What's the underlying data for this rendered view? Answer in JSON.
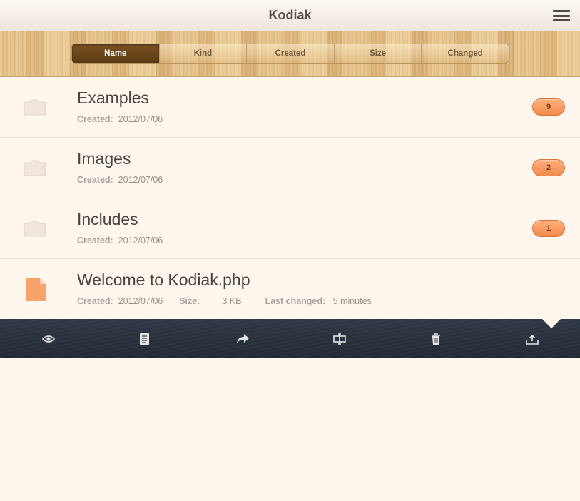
{
  "app": {
    "title": "Kodiak"
  },
  "icons": {
    "menu": "hamburger-menu-icon",
    "folder": "folder-icon",
    "file": "php-file-icon",
    "toolbar": [
      "eye-icon",
      "document-icon",
      "share-arrow-icon",
      "rename-icon",
      "trash-icon",
      "upload-icon"
    ]
  },
  "sort": {
    "options": [
      "Name",
      "Kind",
      "Created",
      "Size",
      "Changed"
    ],
    "active": "Name"
  },
  "items": [
    {
      "name": "Examples",
      "type": "folder",
      "created_label": "Created:",
      "created": "2012/07/06",
      "count": "9"
    },
    {
      "name": "Images",
      "type": "folder",
      "created_label": "Created:",
      "created": "2012/07/06",
      "count": "2"
    },
    {
      "name": "Includes",
      "type": "folder",
      "created_label": "Created:",
      "created": "2012/07/06",
      "count": "1"
    },
    {
      "name": "Welcome to Kodiak.php",
      "type": "file",
      "created_label": "Created:",
      "created": "2012/07/06",
      "size_label": "Size:",
      "size": "3 KB",
      "changed_label": "Last changed:",
      "changed": "5 minutes"
    }
  ],
  "colors": {
    "accent": "#f28a4d",
    "toolbar": "#262e39",
    "background": "#fff6ee"
  }
}
